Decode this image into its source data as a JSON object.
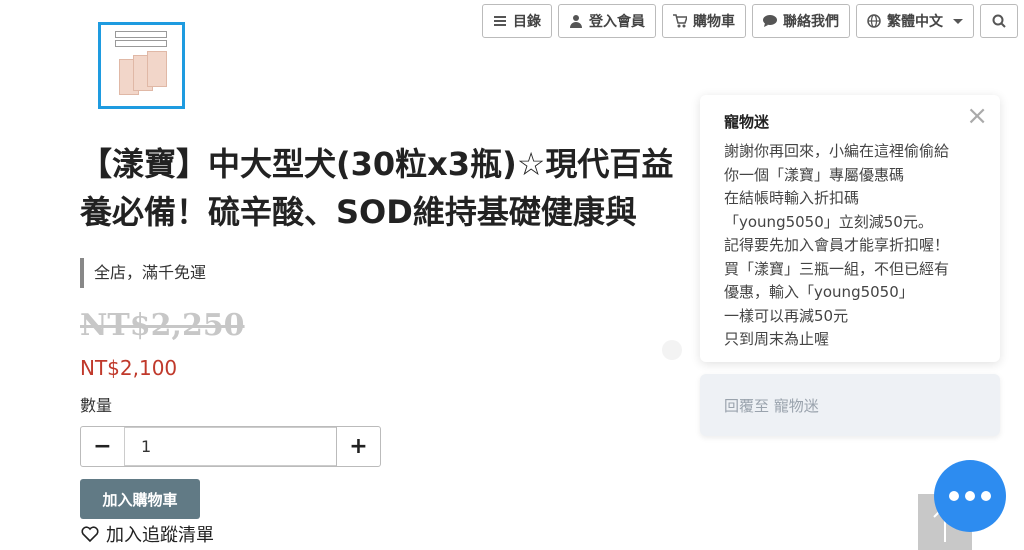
{
  "nav": {
    "menu_label": "目錄",
    "login_label": "登入會員",
    "cart_label": "購物車",
    "contact_label": "聯絡我們",
    "language_label": "繁體中文"
  },
  "product": {
    "title_line1": "【漾寶】中大型犬(30粒x3瓶)☆現代百益",
    "title_line2": "養必備！硫辛酸、SOD維持基礎健康與",
    "promo": "全店，滿千免運",
    "original_price": "NT$2,250",
    "price": "NT$2,100",
    "quantity_label": "數量",
    "quantity_value": "1",
    "add_to_cart_label": "加入購物車",
    "wishlist_label": "加入追蹤清單"
  },
  "chat": {
    "sender": "寵物迷",
    "lines": [
      "謝謝你再回來，小編在這裡偷偷給",
      "你一個「漾寶」專屬優惠碼",
      "在結帳時輸入折扣碼",
      "「young5050」立刻減50元。",
      "記得要先加入會員才能享折扣喔！",
      "買「漾寶」三瓶一組，不但已經有",
      "優惠，輸入「young5050」",
      "一樣可以再減50元",
      "只到周末為止喔"
    ],
    "reply_placeholder": "回覆至 寵物迷"
  },
  "colors": {
    "accent_blue": "#2d8cf0",
    "price_red": "#c0392b",
    "cart_button": "#617a85"
  },
  "icons": [
    "menu-icon",
    "user-icon",
    "cart-icon",
    "chat-icon",
    "globe-icon",
    "search-icon",
    "heart-icon",
    "close-icon",
    "arrow-up-icon"
  ]
}
